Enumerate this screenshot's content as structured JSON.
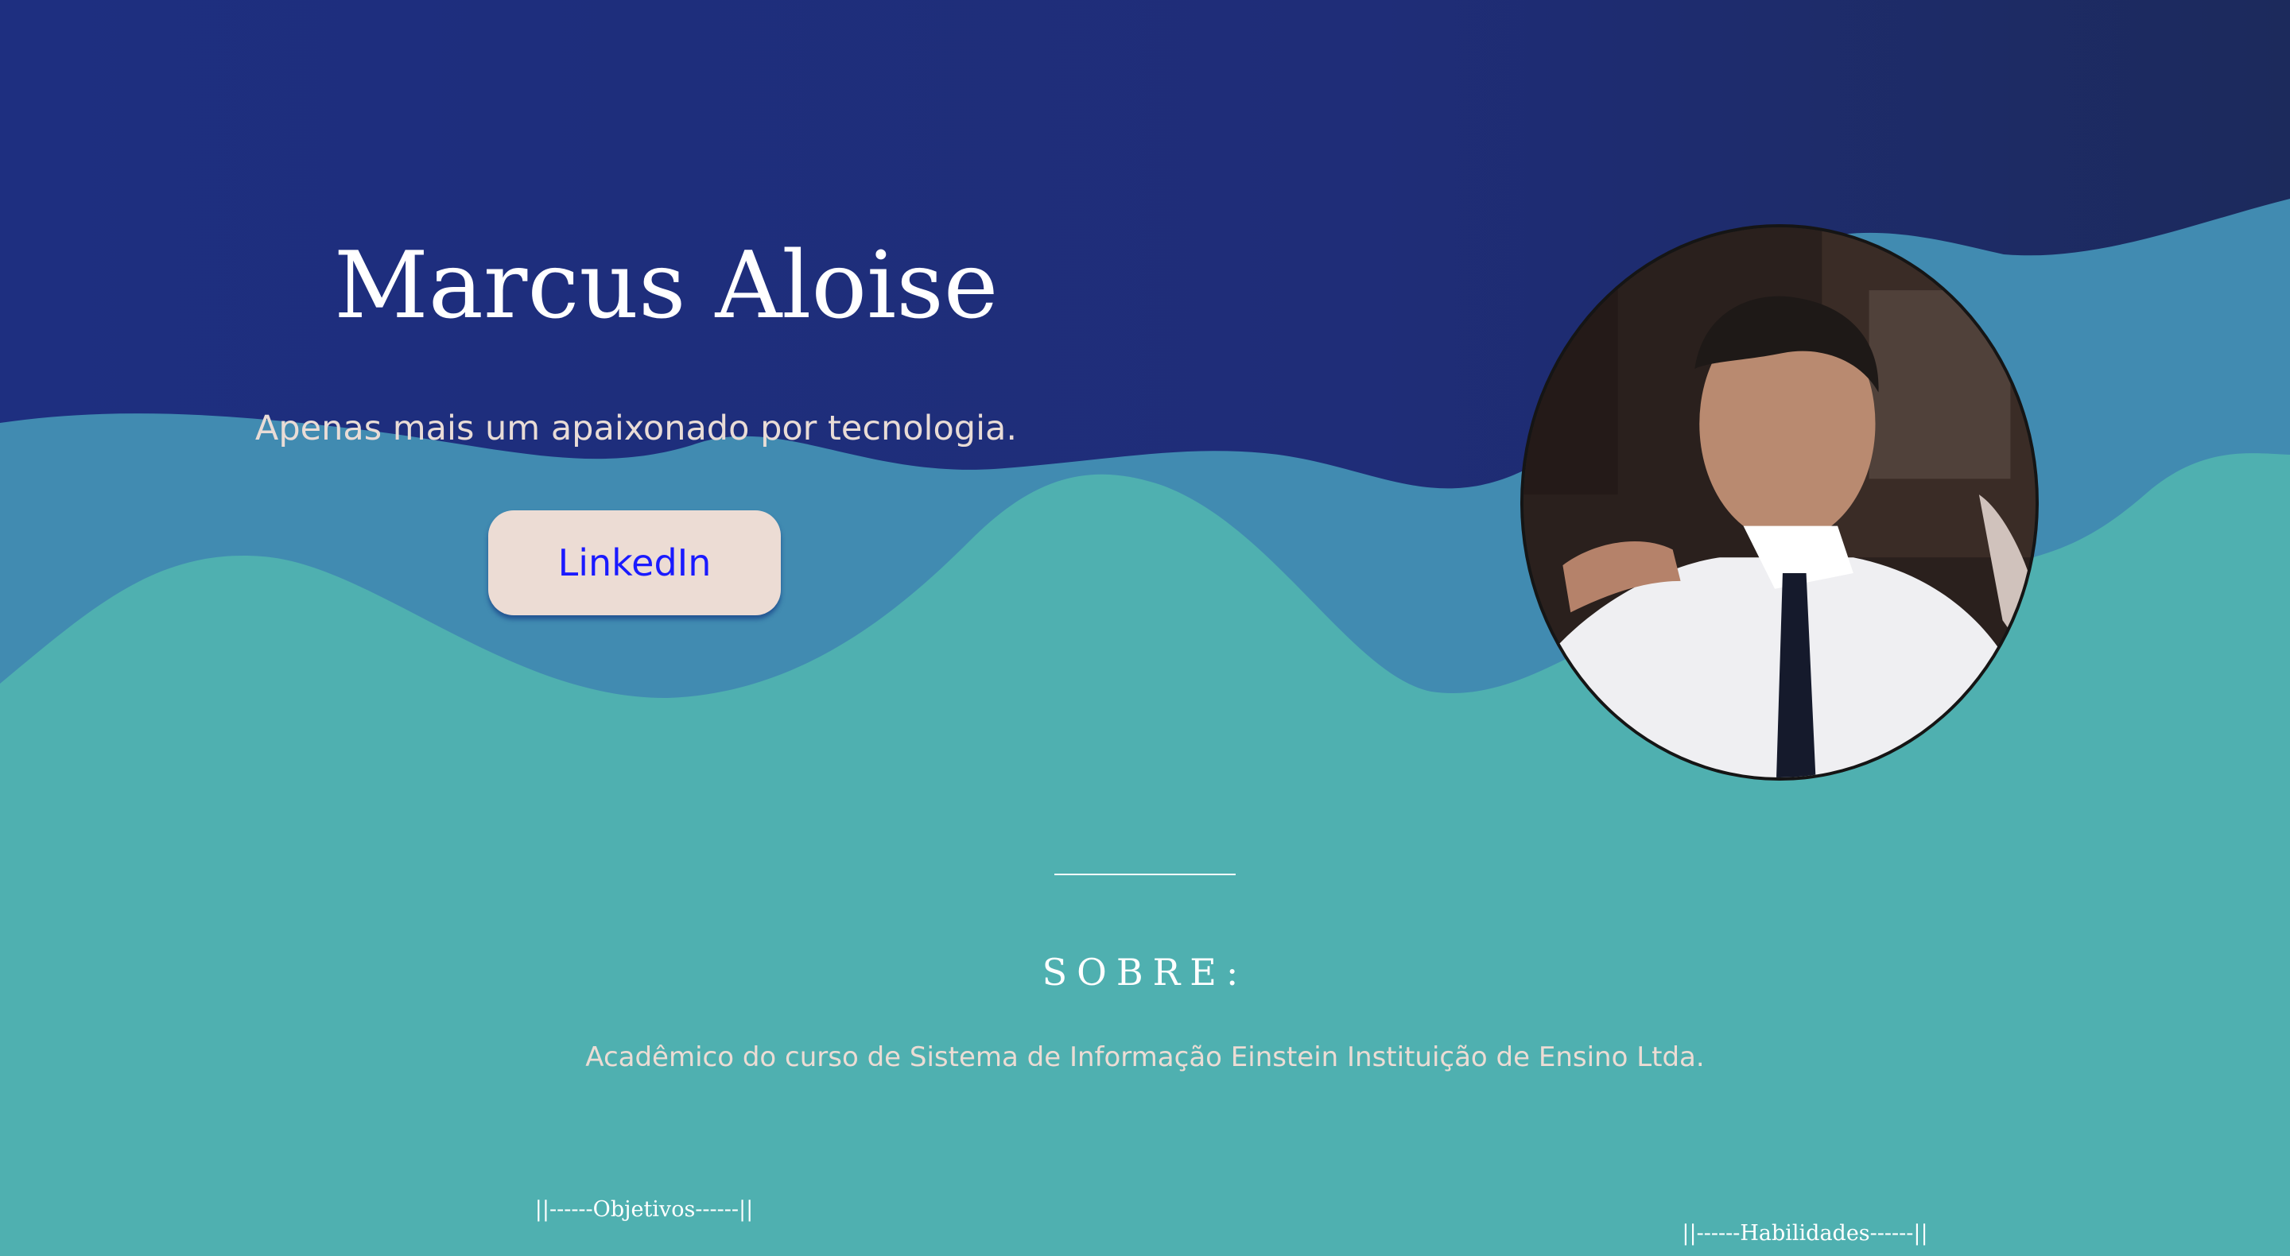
{
  "hero": {
    "name": "Marcus Aloise",
    "tagline": "Apenas mais um apaixonado por tecnologia.",
    "linkedin_label": "LinkedIn"
  },
  "about": {
    "title": "SOBRE:",
    "text": "Acadêmico do curso de Sistema de Informação Einstein Instituição de Ensino Ltda."
  },
  "sections": {
    "objetivos": "||------Objetivos------||",
    "habilidades": "||------Habilidades------||"
  },
  "colors": {
    "navy": "#1e2d7c",
    "wave_blue": "#418bb1",
    "wave_teal": "#4fb0b0",
    "button_bg": "#ecdcd4",
    "link_blue": "#1a1aff",
    "cream_text": "#ecdcd4"
  },
  "icons": {
    "avatar": "profile-photo"
  }
}
